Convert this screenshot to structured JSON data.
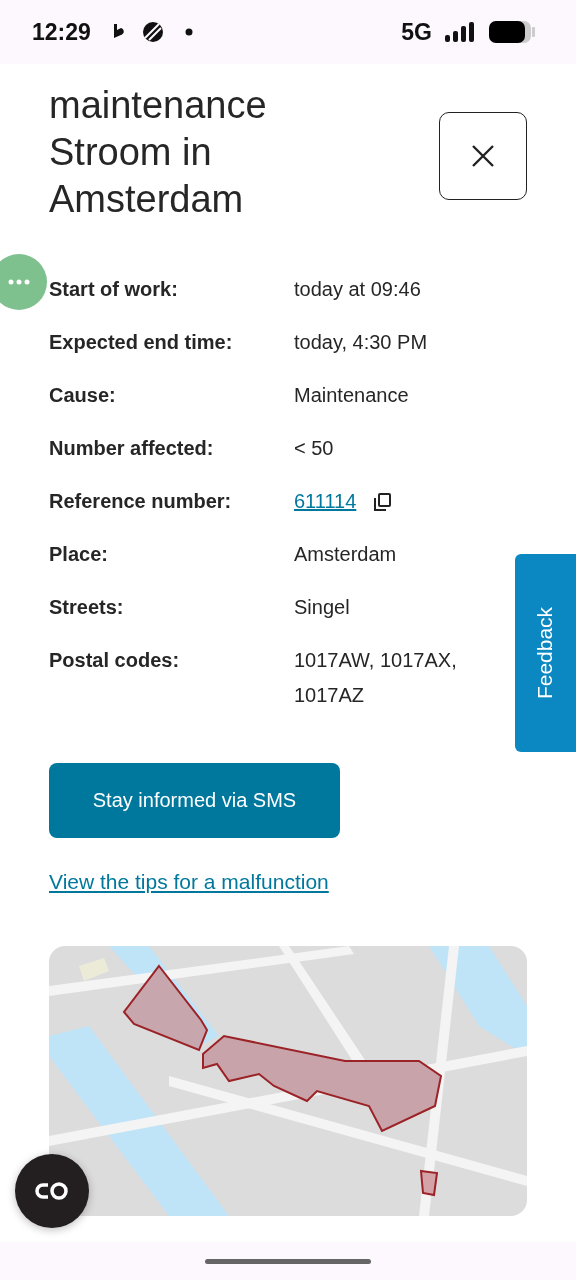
{
  "status_bar": {
    "time": "12:29",
    "network": "5G"
  },
  "title": "maintenance Stroom in Amsterdam",
  "details": [
    {
      "label": "Start of work:",
      "value": "today at 09:46",
      "kind": "text"
    },
    {
      "label": "Expected end time:",
      "value": "today, 4:30 PM",
      "kind": "text"
    },
    {
      "label": "Cause:",
      "value": "Maintenance",
      "kind": "text"
    },
    {
      "label": "Number affected:",
      "value": "< 50",
      "kind": "text"
    },
    {
      "label": "Reference number:",
      "value": "611114",
      "kind": "link"
    },
    {
      "label": "Place:",
      "value": "Amsterdam",
      "kind": "text"
    },
    {
      "label": "Streets:",
      "value": "Singel",
      "kind": "text"
    },
    {
      "label": "Postal codes:",
      "value": "1017AW, 1017AX, 1017AZ",
      "kind": "text"
    }
  ],
  "sms_button": "Stay informed via SMS",
  "tips_link": "View the tips for a malfunction",
  "feedback_tab": "Feedback"
}
